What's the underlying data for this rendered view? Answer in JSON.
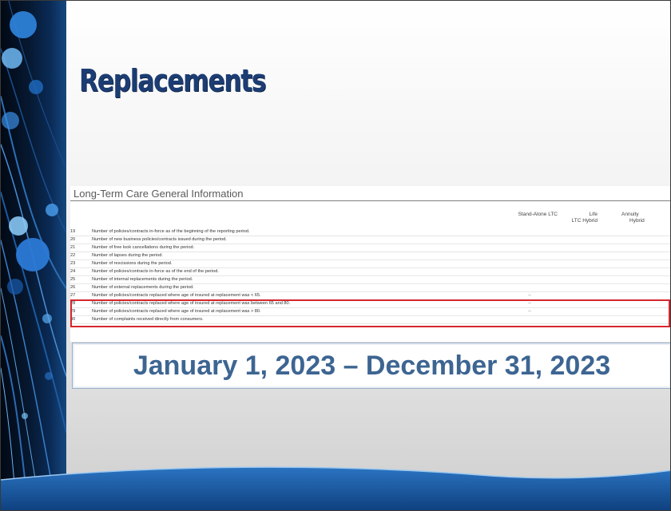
{
  "slide": {
    "title": "Replacements",
    "banner_date_range": "January 1, 2023 – December 31, 2023"
  },
  "sheet": {
    "heading": "Long-Term Care General Information",
    "columns": [
      {
        "line1": "",
        "line2": "Stand-Alone LTC"
      },
      {
        "line1": "Life",
        "line2": "LTC Hybrid"
      },
      {
        "line1": "Annuity",
        "line2": "Hybrid"
      }
    ],
    "rows": [
      {
        "num": "19",
        "desc": "Number of policies/contracts in-force as of the beginning of the reporting period.",
        "standalone": ""
      },
      {
        "num": "20",
        "desc": "Number of new business policies/contracts issued during the period.",
        "standalone": ""
      },
      {
        "num": "21",
        "desc": "Number of free look cancellations during the period.",
        "standalone": ""
      },
      {
        "num": "22",
        "desc": "Number of lapses during the period.",
        "standalone": ""
      },
      {
        "num": "23",
        "desc": "Number of rescissions during the period.",
        "standalone": ""
      },
      {
        "num": "24",
        "desc": "Number of policies/contracts in-force as of the end of the period.",
        "standalone": ""
      },
      {
        "num": "25",
        "desc": "Number of internal replacements during the period.",
        "standalone": ""
      },
      {
        "num": "26",
        "desc": "Number of external replacements during the period.",
        "standalone": ""
      },
      {
        "num": "27",
        "desc": "Number of policies/contracts replaced where age of insured at replacement was < 65.",
        "standalone": "--"
      },
      {
        "num": "28",
        "desc": "Number of policies/contracts replaced where age of insured at replacement was between 65 and 80.",
        "standalone": "--"
      },
      {
        "num": "29",
        "desc": "Number of policies/contracts replaced where age of insured at replacement was > 80.",
        "standalone": "--"
      },
      {
        "num": "30",
        "desc": "Number of complaints received directly from consumers.",
        "standalone": ""
      }
    ]
  },
  "colors": {
    "title": "#1c3d73",
    "highlight_border": "#d6262d",
    "date_text": "#3d6592",
    "footer_band": "#1d5fa8"
  }
}
